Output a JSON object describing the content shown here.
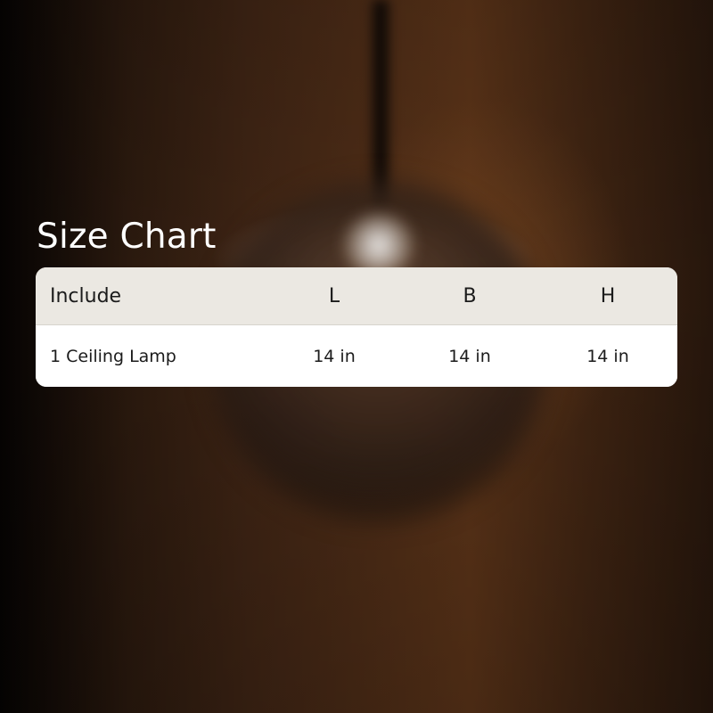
{
  "title": "Size Chart",
  "table": {
    "headers": {
      "include": "Include",
      "l": "L",
      "b": "B",
      "h": "H"
    },
    "rows": [
      {
        "include": "1 Ceiling Lamp",
        "l": "14 in",
        "b": "14 in",
        "h": "14 in"
      }
    ]
  },
  "colors": {
    "header_bg": "#ebe8e2",
    "row_bg": "#ffffff",
    "text": "#1b1b1b",
    "title": "#ffffff"
  }
}
